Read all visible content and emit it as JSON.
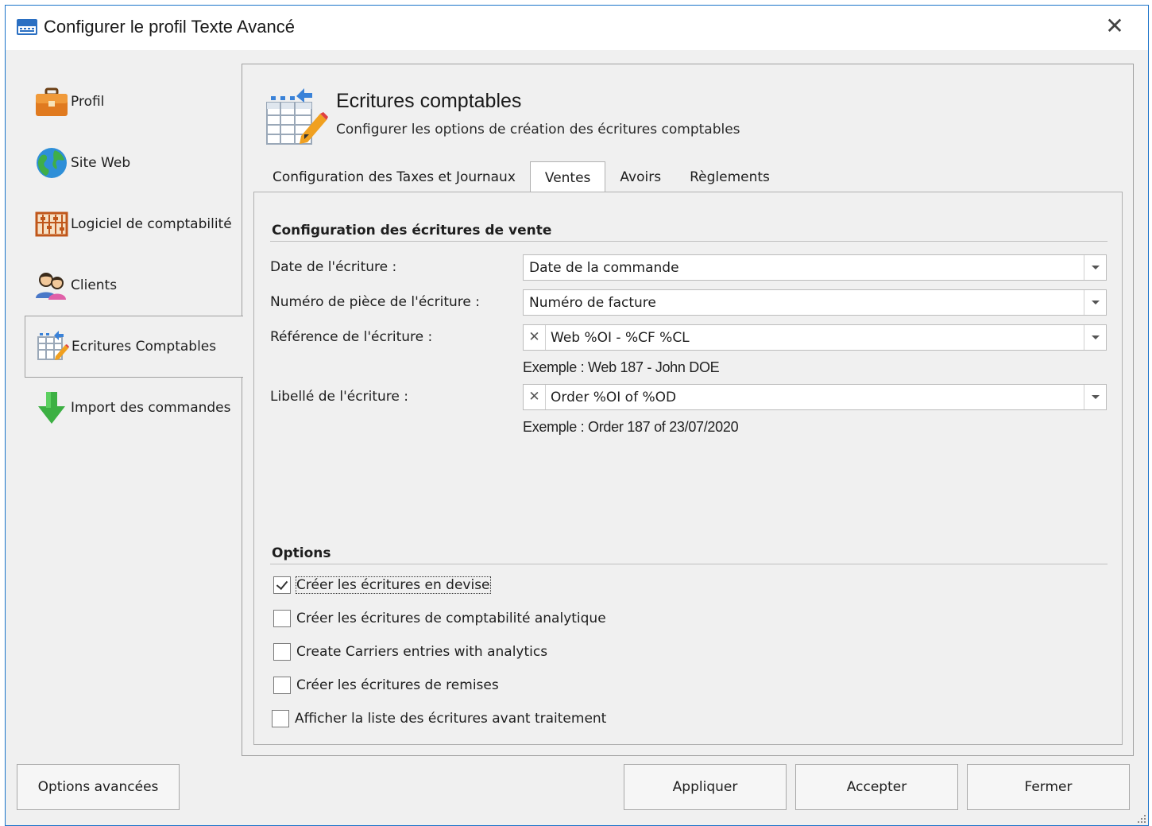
{
  "window": {
    "title": "Configurer le profil Texte Avancé",
    "close_glyph": "✕"
  },
  "sidebar": {
    "items": [
      {
        "label": "Profil",
        "icon": "briefcase-icon"
      },
      {
        "label": "Site Web",
        "icon": "globe-icon"
      },
      {
        "label": "Logiciel de comptabilité",
        "icon": "abacus-icon"
      },
      {
        "label": "Clients",
        "icon": "users-icon"
      },
      {
        "label": "Ecritures Comptables",
        "icon": "spreadsheet-edit-icon",
        "active": true
      },
      {
        "label": "Import des commandes",
        "icon": "arrow-down-icon"
      }
    ]
  },
  "header": {
    "title": "Ecritures comptables",
    "subtitle": "Configurer les options de création des écritures comptables"
  },
  "tabs": [
    {
      "label": "Configuration des Taxes et Journaux"
    },
    {
      "label": "Ventes",
      "active": true
    },
    {
      "label": "Avoirs"
    },
    {
      "label": "Règlements"
    }
  ],
  "sales": {
    "section_title": "Configuration des écritures de vente",
    "date_label": "Date de l'écriture :",
    "date_value": "Date de la commande",
    "piece_label": "Numéro de pièce de l'écriture :",
    "piece_value": "Numéro de facture",
    "ref_label": "Référence de l'écriture :",
    "ref_value": "Web %OI - %CF %CL",
    "ref_example": "Exemple : Web 187 - John DOE",
    "libelle_label": "Libellé de l'écriture :",
    "libelle_value": "Order %OI of %OD",
    "libelle_example": "Exemple : Order 187 of 23/07/2020",
    "clear_glyph": "✕"
  },
  "options": {
    "section_title": "Options",
    "items": [
      {
        "label": "Créer les écritures en devise",
        "checked": true
      },
      {
        "label": "Créer les écritures de comptabilité analytique",
        "checked": false
      },
      {
        "label": "Create Carriers entries with analytics",
        "checked": false
      },
      {
        "label": "Créer les écritures de remises",
        "checked": false
      },
      {
        "label": "Afficher la liste des écritures avant traitement",
        "checked": false
      }
    ]
  },
  "buttons": {
    "advanced": "Options avancées",
    "apply": "Appliquer",
    "accept": "Accepter",
    "close": "Fermer"
  },
  "colors": {
    "window_border": "#1a73c9",
    "background": "#f0f0f0"
  }
}
